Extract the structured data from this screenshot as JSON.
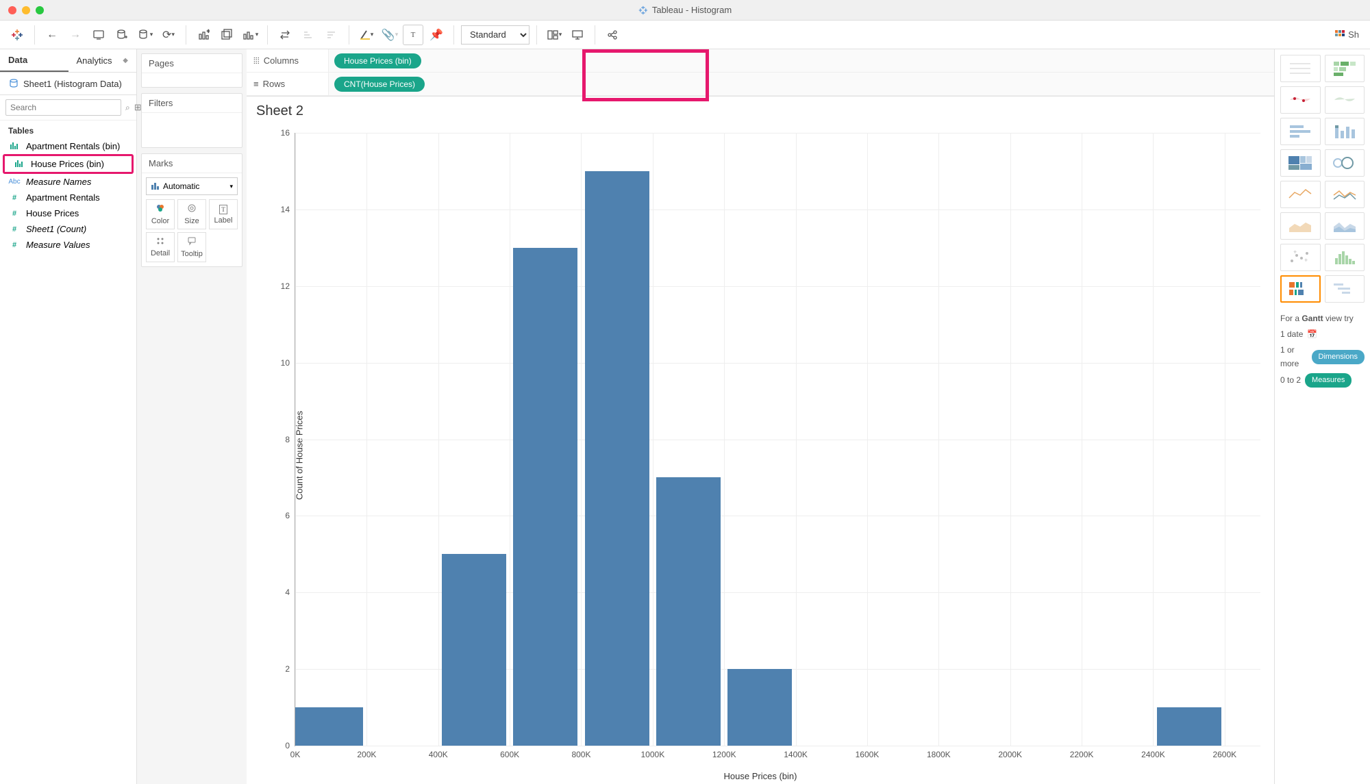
{
  "window": {
    "title": "Tableau - Histogram"
  },
  "toolbar": {
    "fit_mode": "Standard",
    "show_me_label": "Sh"
  },
  "datapane": {
    "tab_data": "Data",
    "tab_analytics": "Analytics",
    "datasource": "Sheet1 (Histogram Data)",
    "search_placeholder": "Search",
    "tables_label": "Tables",
    "fields": [
      {
        "icon": "bars-green",
        "label": "Apartment Rentals (bin)",
        "type": "dim"
      },
      {
        "icon": "bars-green",
        "label": "House Prices (bin)",
        "type": "dim",
        "highlighted": true
      },
      {
        "icon": "Abc",
        "label": "Measure Names",
        "type": "dim",
        "italic": true
      },
      {
        "icon": "#",
        "label": "Apartment Rentals",
        "type": "meas"
      },
      {
        "icon": "#",
        "label": "House Prices",
        "type": "meas"
      },
      {
        "icon": "#",
        "label": "Sheet1 (Count)",
        "type": "meas",
        "italic": true
      },
      {
        "icon": "#",
        "label": "Measure Values",
        "type": "meas",
        "italic": true
      }
    ]
  },
  "cards": {
    "pages": "Pages",
    "filters": "Filters",
    "marks": "Marks",
    "mark_type": "Automatic",
    "mark_cells": [
      "Color",
      "Size",
      "Label",
      "Detail",
      "Tooltip"
    ]
  },
  "shelves": {
    "columns_label": "Columns",
    "rows_label": "Rows",
    "columns_pill": "House Prices (bin)",
    "rows_pill": "CNT(House Prices)"
  },
  "sheet": {
    "title": "Sheet 2"
  },
  "chart_data": {
    "type": "bar",
    "title": "Sheet 2",
    "xlabel": "House Prices (bin)",
    "ylabel": "Count of House Prices",
    "x_ticks": [
      "0K",
      "200K",
      "400K",
      "600K",
      "800K",
      "1000K",
      "1200K",
      "1400K",
      "1600K",
      "1800K",
      "2000K",
      "2200K",
      "2400K",
      "2600K"
    ],
    "y_ticks": [
      0,
      2,
      4,
      6,
      8,
      10,
      12,
      14,
      16
    ],
    "ylim": [
      0,
      16
    ],
    "categories": [
      "0K",
      "200K",
      "400K",
      "600K",
      "800K",
      "1000K",
      "1200K",
      "1400K",
      "1600K",
      "1800K",
      "2000K",
      "2200K",
      "2400K",
      "2600K"
    ],
    "values": [
      1,
      0,
      5,
      13,
      15,
      7,
      2,
      0,
      0,
      0,
      0,
      0,
      1,
      0,
      1
    ]
  },
  "showme": {
    "hint_prefix": "For a ",
    "hint_bold": "Gantt",
    "hint_suffix": " view try",
    "line_date": "1 date",
    "line_dim_prefix": "1 or more",
    "line_dim_pill": "Dimensions",
    "line_meas_prefix": "0 to 2",
    "line_meas_pill": "Measures"
  }
}
